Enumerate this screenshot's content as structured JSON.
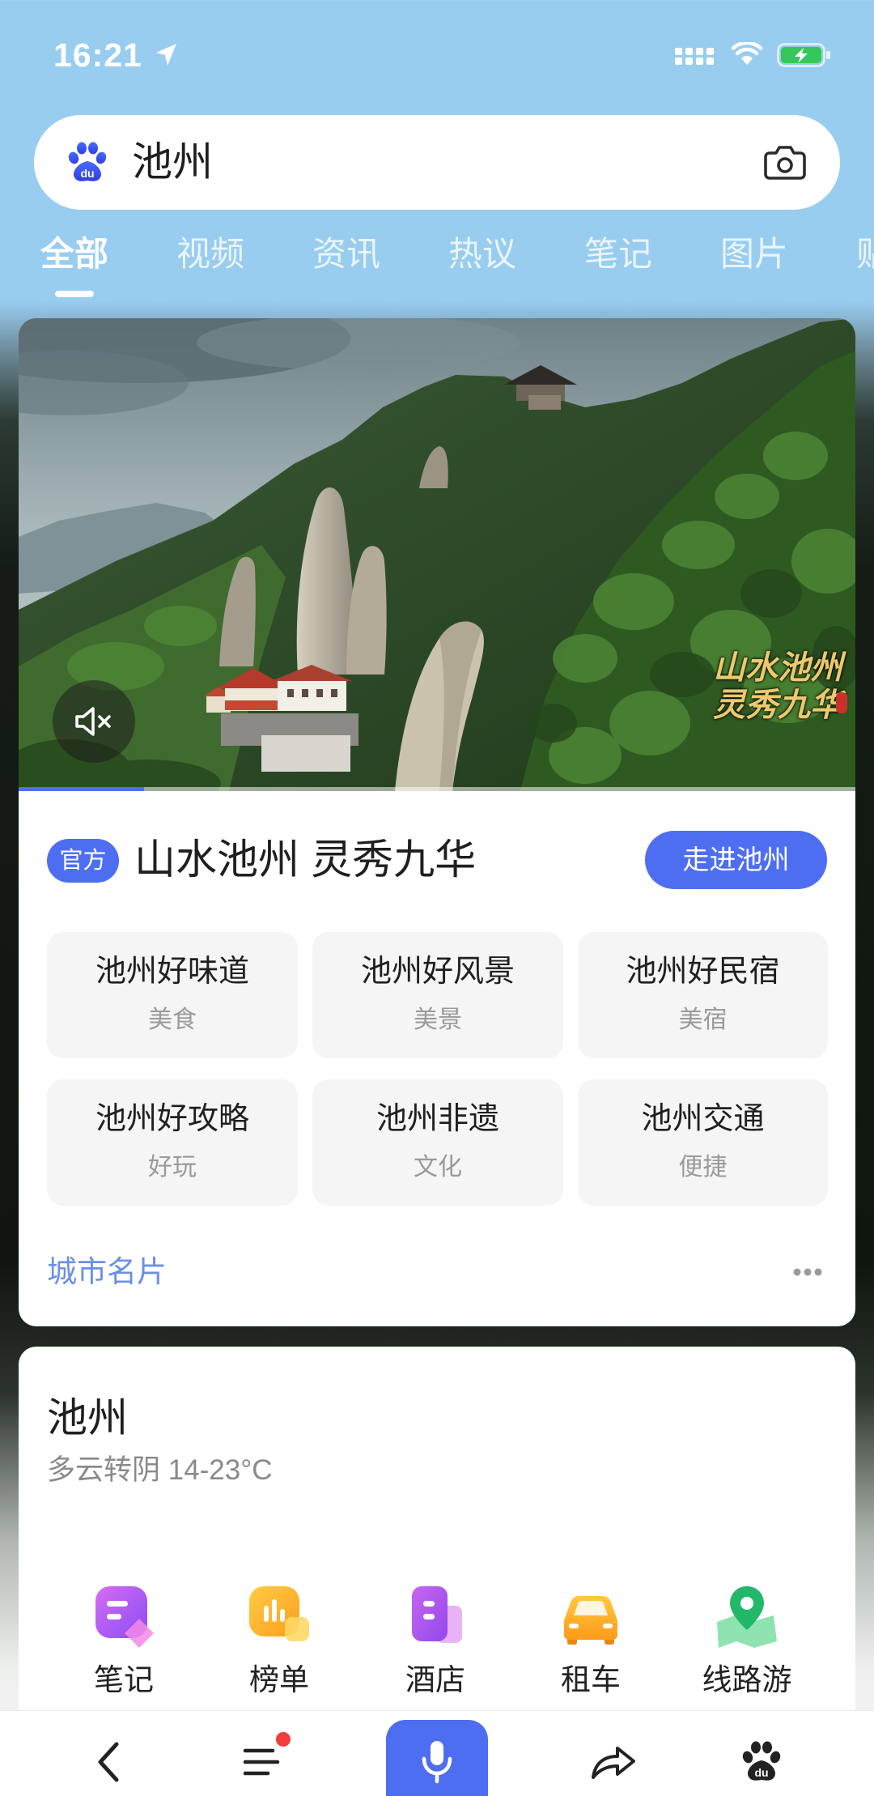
{
  "status_bar": {
    "time": "16:21"
  },
  "search": {
    "query": "池州",
    "logo_text": "du",
    "icons": [
      "baidu-paw-icon",
      "camera-icon"
    ]
  },
  "tabs": [
    {
      "label": "全部",
      "active": true
    },
    {
      "label": "视频",
      "active": false
    },
    {
      "label": "资讯",
      "active": false
    },
    {
      "label": "热议",
      "active": false
    },
    {
      "label": "笔记",
      "active": false
    },
    {
      "label": "图片",
      "active": false
    },
    {
      "label": "贴吧",
      "active": false
    }
  ],
  "video": {
    "watermark": [
      "山水池州",
      "灵秀九华"
    ],
    "muted": true,
    "progress": 0.15
  },
  "official_card": {
    "badge": "官方",
    "title": "山水池州 灵秀九华",
    "cta": "走进池州",
    "tiles": [
      {
        "title": "池州好味道",
        "subtitle": "美食"
      },
      {
        "title": "池州好风景",
        "subtitle": "美景"
      },
      {
        "title": "池州好民宿",
        "subtitle": "美宿"
      },
      {
        "title": "池州好攻略",
        "subtitle": "好玩"
      },
      {
        "title": "池州非遗",
        "subtitle": "文化"
      },
      {
        "title": "池州交通",
        "subtitle": "便捷"
      }
    ],
    "footer_label": "城市名片"
  },
  "weather_card": {
    "city": "池州",
    "forecast": "多云转阴 14-23°C",
    "services": [
      {
        "label": "笔记",
        "icon": "note-icon"
      },
      {
        "label": "榜单",
        "icon": "rankings-icon"
      },
      {
        "label": "酒店",
        "icon": "hotel-icon"
      },
      {
        "label": "租车",
        "icon": "car-icon"
      },
      {
        "label": "线路游",
        "icon": "map-pin-icon"
      }
    ]
  },
  "bottom_nav": [
    {
      "icon": "back-icon"
    },
    {
      "icon": "menu-icon",
      "badge_dot": true
    },
    {
      "icon": "mic-icon"
    },
    {
      "icon": "share-icon"
    },
    {
      "icon": "baidu-paw-icon"
    }
  ],
  "colors": {
    "accent": "#4e6ef2",
    "link": "#6b8fe6",
    "header_bg": "#98cdf0",
    "badge_dot": "#f23c3c"
  }
}
